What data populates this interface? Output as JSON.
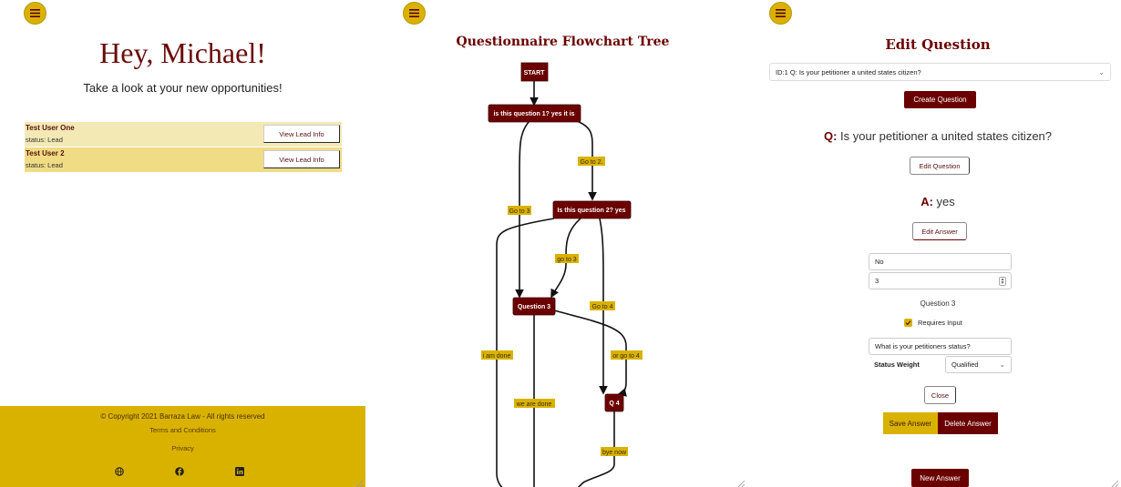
{
  "panel1": {
    "greeting": "Hey, Michael!",
    "subtitle": "Take a look at your new opportunities!",
    "leads": [
      {
        "name": "Test User One",
        "status": "status: Lead",
        "button": "View Lead Info"
      },
      {
        "name": "Test User 2",
        "status": "status: Lead",
        "button": "View Lead Info"
      }
    ],
    "footer": {
      "copyright": "© Copyright 2021 Barraza Law - All rights reserved",
      "terms": "Terms and Conditions",
      "privacy": "Privacy",
      "social_icons": [
        "globe-icon",
        "facebook-icon",
        "linkedin-icon"
      ]
    }
  },
  "panel2": {
    "title": "Questionnaire Flowchart Tree",
    "nodes": {
      "start": "START",
      "q1": "is this question 1? yes it is",
      "q2": "Is this question 2? yes",
      "q3": "Question 3",
      "q4": "Q 4"
    },
    "edges": {
      "go_to_2": "Go to 2.",
      "go_to_3_a": "Go to 3",
      "go_to_3_b": "go to 3",
      "go_to_4": "Go to 4",
      "i_am_done": "i am done",
      "or_go_to_4": "or go to 4",
      "we_are_done": "we are done",
      "bye_now": "bye now"
    }
  },
  "panel3": {
    "title": "Edit Question",
    "question_select": "ID:1 Q: Is your petitioner a united states citizen?",
    "create_question": "Create Question",
    "q_prefix": "Q:",
    "question_text": "Is your petitioner a united states citizen?",
    "edit_question": "Edit Question",
    "a_prefix": "A:",
    "answer_text": "yes",
    "edit_answer": "Edit Answer",
    "answer_field": "No",
    "number_field": "3",
    "next_question_label": "Question 3",
    "requires_input_label": "Requires Input",
    "requires_input_checked": true,
    "input_prompt": "What is your petitioners status?",
    "status_weight_label": "Status Weight",
    "status_weight_value": "Qualified",
    "close": "Close",
    "save_answer": "Save Answer",
    "delete_answer": "Delete Answer",
    "new_answer": "New Answer"
  },
  "colors": {
    "maroon": "#6b0000",
    "gold": "#d9b200",
    "lead_row_light": "#f3e9b5",
    "lead_row_dark": "#efdc84"
  }
}
